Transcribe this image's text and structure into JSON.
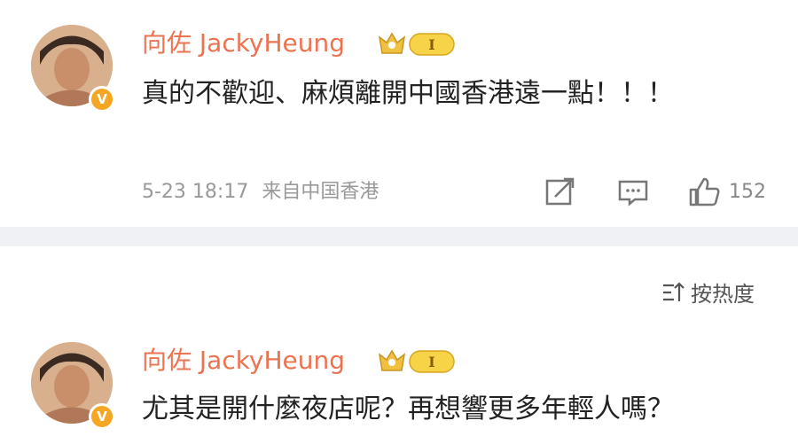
{
  "comments": [
    {
      "username": "向佐 JackyHeung",
      "verified_badge": "V",
      "level_badge": "I",
      "text": "真的不歡迎、麻煩離開中國香港遠一點！！！",
      "timestamp": "5-23 18:17",
      "location": "来自中国香港",
      "likes": "152",
      "icons": [
        "share-icon",
        "comment-icon",
        "like-icon"
      ]
    },
    {
      "username": "向佐 JackyHeung",
      "verified_badge": "V",
      "level_badge": "I",
      "text": "尤其是開什麼夜店呢？再想響更多年輕人嗎？"
    }
  ],
  "sort": {
    "label": "按热度",
    "icon": "sort-icon"
  },
  "colors": {
    "username": "#eb7350",
    "badge": "#f5a623",
    "divider": "#f0f1f4"
  }
}
